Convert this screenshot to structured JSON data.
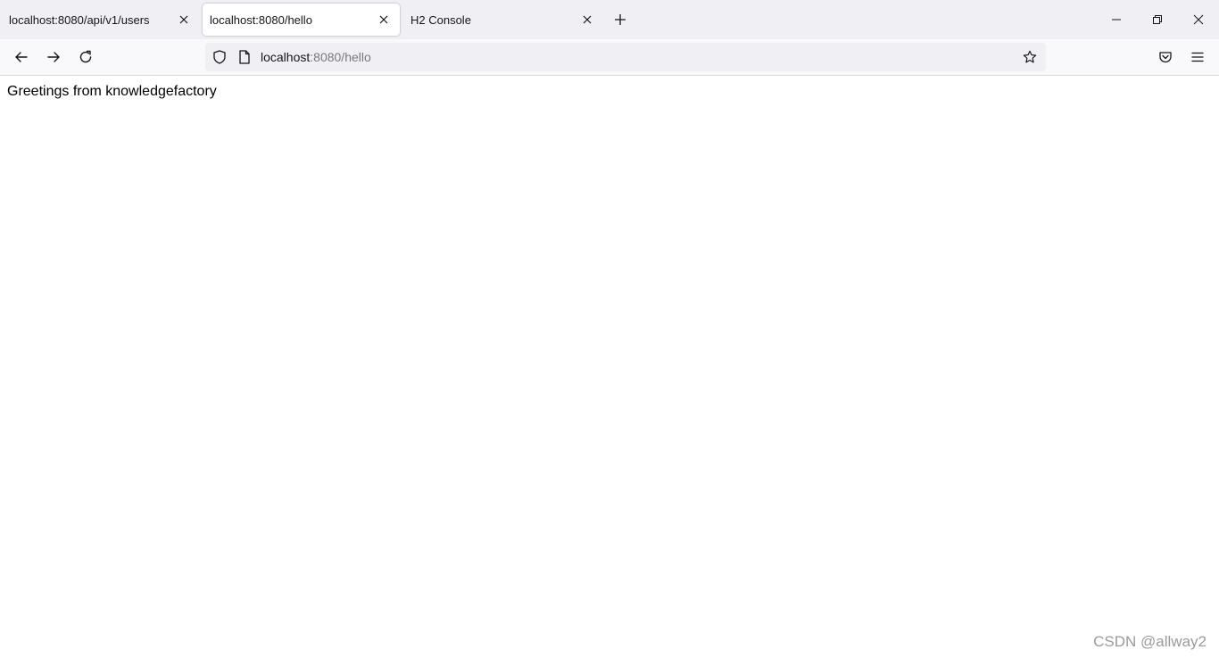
{
  "tabs": [
    {
      "label": "localhost:8080/api/v1/users",
      "active": false
    },
    {
      "label": "localhost:8080/hello",
      "active": true
    },
    {
      "label": "H2 Console",
      "active": false
    }
  ],
  "urlbar": {
    "host": "localhost",
    "path": ":8080/hello"
  },
  "page": {
    "text": "Greetings from knowledgefactory"
  },
  "watermark": "CSDN @allway2",
  "colors": {
    "tabstrip": "#f0f0f4",
    "navbar": "#f9f9fb",
    "urlbar": "#f0f0f4"
  },
  "icons": {
    "tab_close": "close-icon",
    "new_tab": "plus-icon",
    "back": "arrow-left-icon",
    "forward": "arrow-right-icon",
    "reload": "reload-icon",
    "shield": "shield-icon",
    "page": "page-icon",
    "bookmark": "star-icon",
    "pocket": "pocket-icon",
    "menu": "hamburger-menu-icon",
    "minimize": "minimize-icon",
    "restore": "restore-icon",
    "close_window": "close-window-icon"
  }
}
